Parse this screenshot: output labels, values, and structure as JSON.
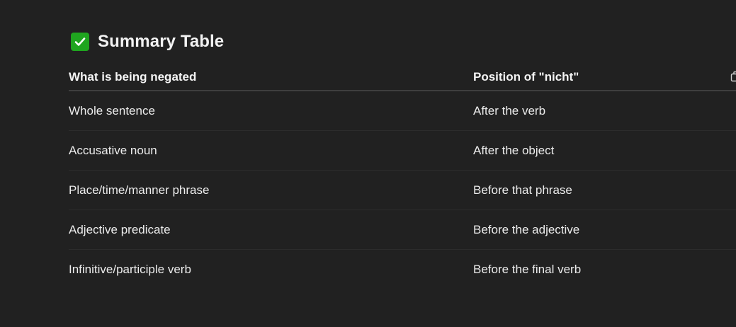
{
  "heading": {
    "icon": "white-check-mark-emoji-icon",
    "title": "Summary Table",
    "icon_color": "#1fa51f"
  },
  "table": {
    "columns": [
      "What is being negated",
      "Position of \"nicht\""
    ],
    "rows": [
      [
        "Whole sentence",
        "After the verb"
      ],
      [
        "Accusative noun",
        "After the object"
      ],
      [
        "Place/time/manner phrase",
        "Before that phrase"
      ],
      [
        "Adjective predicate",
        "Before the adjective"
      ],
      [
        "Infinitive/participle verb",
        "Before the final verb"
      ]
    ],
    "copy_icon": "copy-icon"
  },
  "colors": {
    "background": "#212121",
    "text": "#ececec",
    "divider": "#2c2c2c"
  }
}
